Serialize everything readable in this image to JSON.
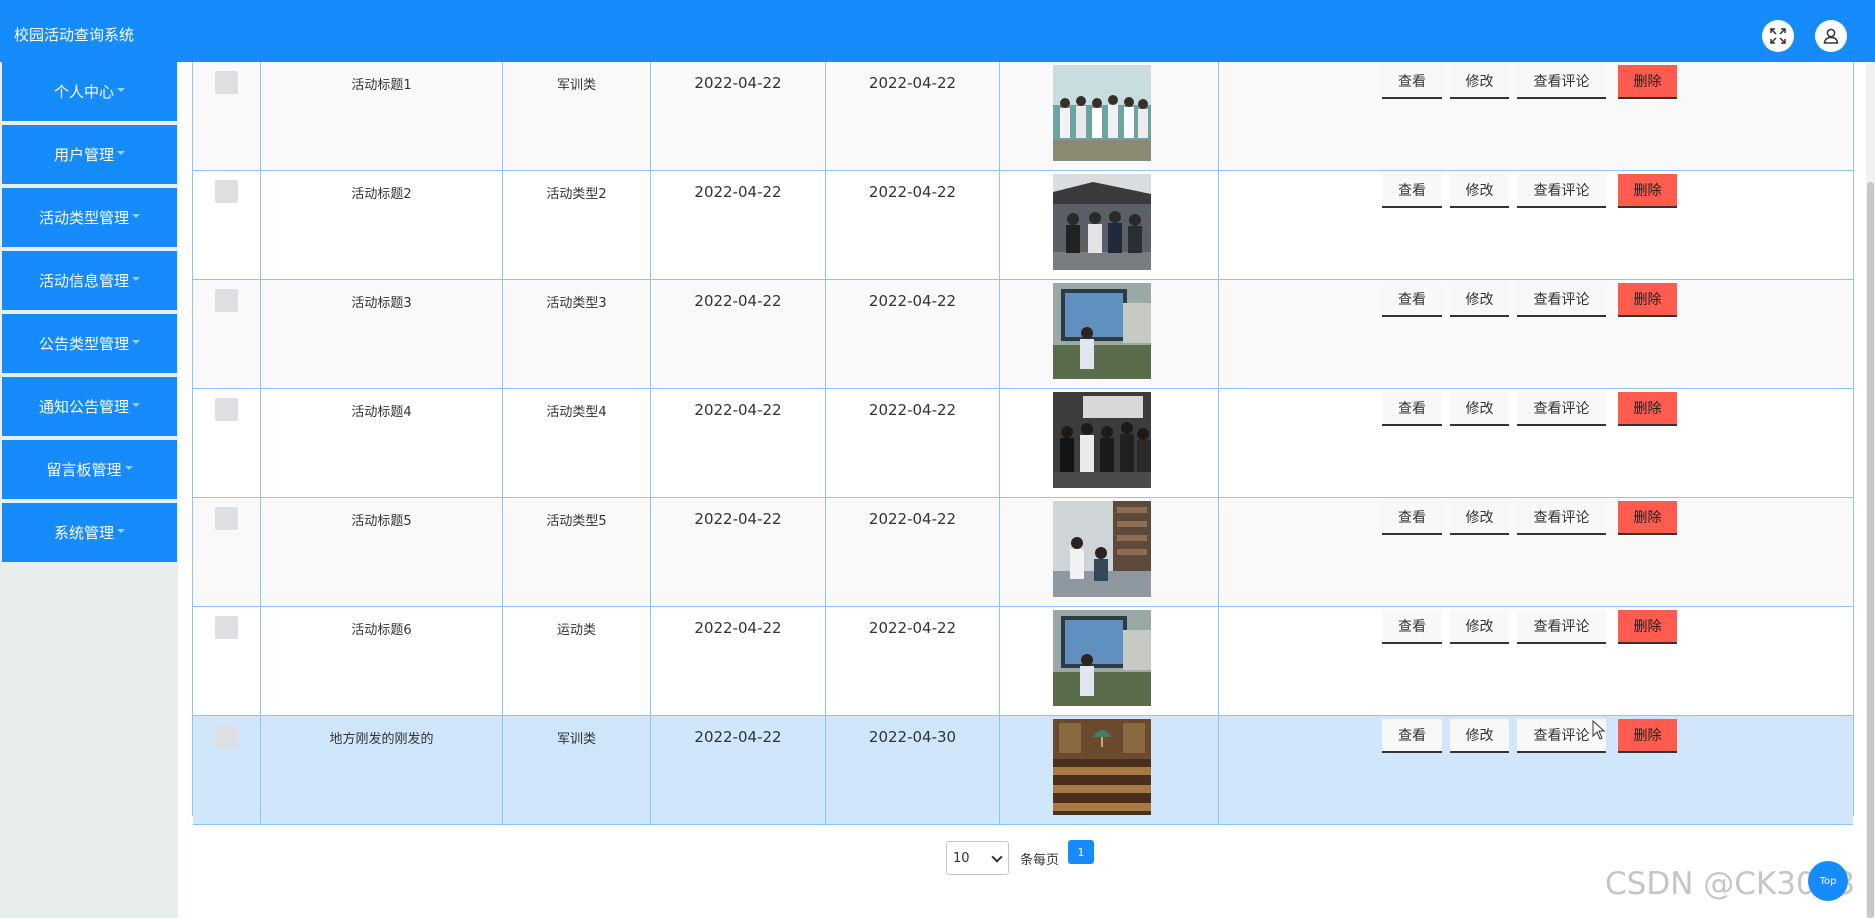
{
  "header": {
    "app_title": "校园活动查询系统",
    "fullscreen_icon": "fullscreen-icon",
    "user_icon": "user-icon"
  },
  "sidebar": {
    "items": [
      {
        "label": "个人中心"
      },
      {
        "label": "用户管理"
      },
      {
        "label": "活动类型管理"
      },
      {
        "label": "活动信息管理"
      },
      {
        "label": "公告类型管理"
      },
      {
        "label": "通知公告管理"
      },
      {
        "label": "留言板管理"
      },
      {
        "label": "系统管理"
      }
    ]
  },
  "table": {
    "rows": [
      {
        "title": "活动标题1",
        "type": "军训类",
        "date1": "2022-04-22",
        "date2": "2022-04-22",
        "photo": "group-outdoor"
      },
      {
        "title": "活动标题2",
        "type": "活动类型2",
        "date1": "2022-04-22",
        "date2": "2022-04-22",
        "photo": "group-street"
      },
      {
        "title": "活动标题3",
        "type": "活动类型3",
        "date1": "2022-04-22",
        "date2": "2022-04-22",
        "photo": "person-screen"
      },
      {
        "title": "活动标题4",
        "type": "活动类型4",
        "date1": "2022-04-22",
        "date2": "2022-04-22",
        "photo": "group-indoor"
      },
      {
        "title": "活动标题5",
        "type": "活动类型5",
        "date1": "2022-04-22",
        "date2": "2022-04-22",
        "photo": "library-meeting"
      },
      {
        "title": "活动标题6",
        "type": "运动类",
        "date1": "2022-04-22",
        "date2": "2022-04-22",
        "photo": "person-screen"
      },
      {
        "title": "地方刚发的刚发的",
        "type": "军训类",
        "date1": "2022-04-22",
        "date2": "2022-04-30",
        "photo": "library-hall"
      }
    ],
    "actions": {
      "view": "查看",
      "edit": "修改",
      "comments": "查看评论",
      "delete": "删除"
    }
  },
  "pagination": {
    "page_size": "10",
    "per_page_label": "条每页",
    "current_page": "1"
  },
  "watermark": "CSDN @CK3043",
  "back_to_top_label": "Top",
  "colors": {
    "primary": "#168bfb",
    "delete": "#ff5b4f",
    "selected_row": "#cfe6fb",
    "border": "#8fc3f0"
  }
}
